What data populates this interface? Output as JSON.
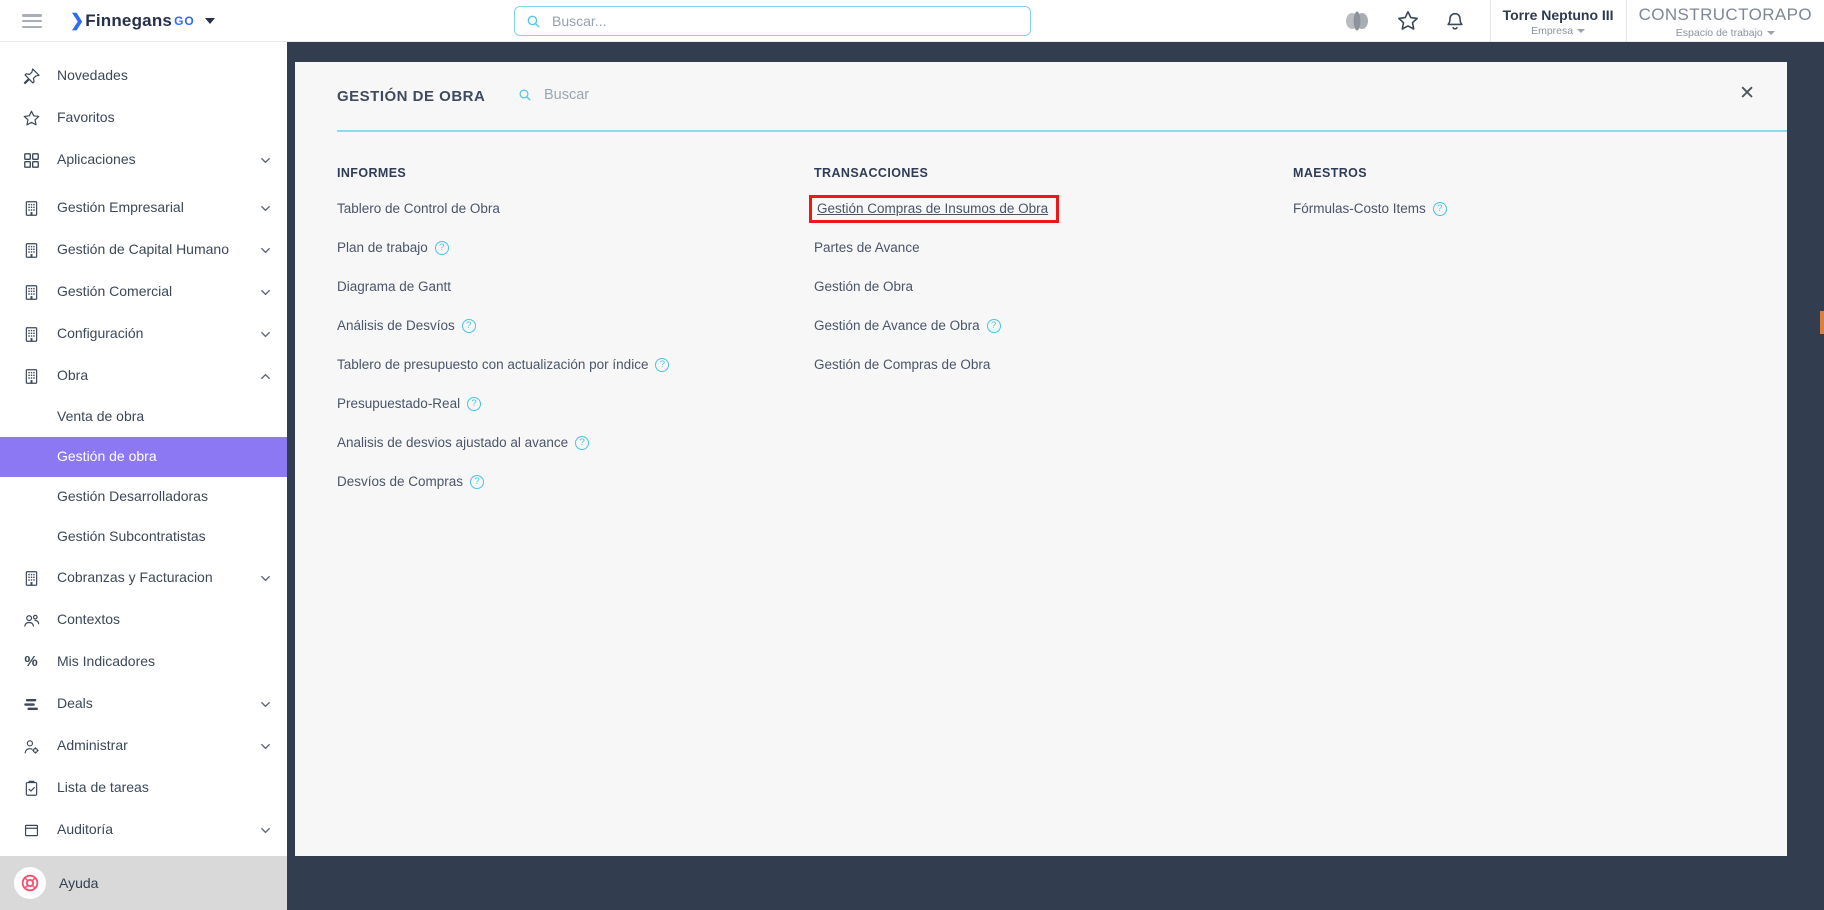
{
  "topbar": {
    "logo": {
      "brand": "Finnegans",
      "suffix": "GO"
    },
    "search": {
      "placeholder": "Buscar..."
    },
    "icons": [
      "assistant-icon",
      "favorites-star-icon",
      "notifications-bell-icon"
    ],
    "company": {
      "name": "Torre Neptuno III",
      "label": "Empresa"
    },
    "workspace": {
      "name": "CONSTRUCTORAPO",
      "label": "Espacio de trabajo"
    }
  },
  "sidebar": {
    "items": [
      {
        "label": "Novedades",
        "icon": "pin-icon"
      },
      {
        "label": "Favoritos",
        "icon": "star-icon"
      },
      {
        "label": "Aplicaciones",
        "icon": "grid-icon",
        "chevron": "down"
      },
      {
        "label": "Gestión Empresarial",
        "icon": "building-icon",
        "chevron": "down",
        "gap": true
      },
      {
        "label": "Gestión de Capital Humano",
        "icon": "building-icon",
        "chevron": "down"
      },
      {
        "label": "Gestión Comercial",
        "icon": "building-icon",
        "chevron": "down"
      },
      {
        "label": "Configuración",
        "icon": "building-icon",
        "chevron": "down"
      },
      {
        "label": "Obra",
        "icon": "building-icon",
        "chevron": "up"
      },
      {
        "label": "Venta de obra",
        "sub": true
      },
      {
        "label": "Gestión de obra",
        "sub": true,
        "selected": true
      },
      {
        "label": "Gestión Desarrolladoras",
        "sub": true
      },
      {
        "label": "Gestión Subcontratistas",
        "sub": true
      },
      {
        "label": "Cobranzas y Facturacion",
        "icon": "building-icon",
        "chevron": "down"
      },
      {
        "label": "Contextos",
        "icon": "people-icon"
      },
      {
        "label": "Mis Indicadores",
        "icon": "percent-icon"
      },
      {
        "label": "Deals",
        "icon": "stacked-bars-icon",
        "chevron": "down"
      },
      {
        "label": "Administrar",
        "icon": "user-gear-icon",
        "chevron": "down"
      },
      {
        "label": "Lista de tareas",
        "icon": "clipboard-check-icon"
      },
      {
        "label": "Auditoría",
        "icon": "window-icon",
        "chevron": "down"
      }
    ],
    "help_label": "Ayuda"
  },
  "panel": {
    "title": "GESTIÓN DE OBRA",
    "search_placeholder": "Buscar",
    "columns": [
      {
        "header": "INFORMES",
        "items": [
          {
            "label": "Tablero de Control de Obra"
          },
          {
            "label": "Plan de trabajo",
            "help": true
          },
          {
            "label": "Diagrama de Gantt"
          },
          {
            "label": "Análisis de Desvíos",
            "help": true
          },
          {
            "label": "Tablero de presupuesto con actualización por índice",
            "help": true
          },
          {
            "label": "Presupuestado-Real",
            "help": true
          },
          {
            "label": "Analisis de desvios ajustado al avance",
            "help": true
          },
          {
            "label": "Desvíos de Compras",
            "help": true
          }
        ]
      },
      {
        "header": "TRANSACCIONES",
        "items": [
          {
            "label": "Gestión Compras de Insumos de Obra",
            "highlighted": true
          },
          {
            "label": "Partes de Avance"
          },
          {
            "label": "Gestión de Obra"
          },
          {
            "label": "Gestión de Avance de Obra",
            "help": true
          },
          {
            "label": "Gestión de Compras de Obra"
          }
        ]
      },
      {
        "header": "MAESTROS",
        "items": [
          {
            "label": "Fórmulas-Costo Items",
            "help": true
          }
        ]
      }
    ]
  },
  "colors": {
    "backdrop": "#323e50",
    "sidebar_selected": "#8b78f2",
    "accent_cyan": "#7fd3ea",
    "panel_underline": "#8fd9ee",
    "highlight_red": "#ee1616",
    "lifebuoy_red": "#f4516c",
    "edge_accent": "#db8040",
    "logo_blue": "#2e6bf6",
    "text_dark": "#3c4858"
  }
}
